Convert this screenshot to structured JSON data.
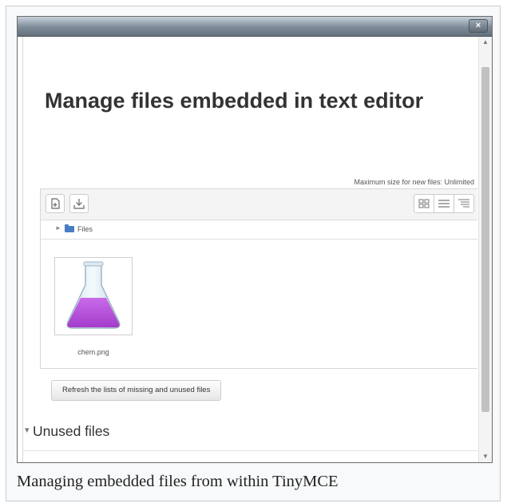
{
  "window": {
    "close_label": "×"
  },
  "page": {
    "title": "Manage files embedded in text editor",
    "max_size_text": "Maximum size for new files: Unlimited"
  },
  "filepicker": {
    "path_label": "Files",
    "files": [
      {
        "name": "chem.png",
        "icon": "flask-image"
      }
    ]
  },
  "actions": {
    "refresh_label": "Refresh the lists of missing and unused files"
  },
  "sections": {
    "unused_files_label": "Unused files"
  },
  "caption": "Managing embedded files from within TinyMCE",
  "colors": {
    "flask_liquid": "#b64fdc",
    "folder": "#4a7cc2"
  }
}
